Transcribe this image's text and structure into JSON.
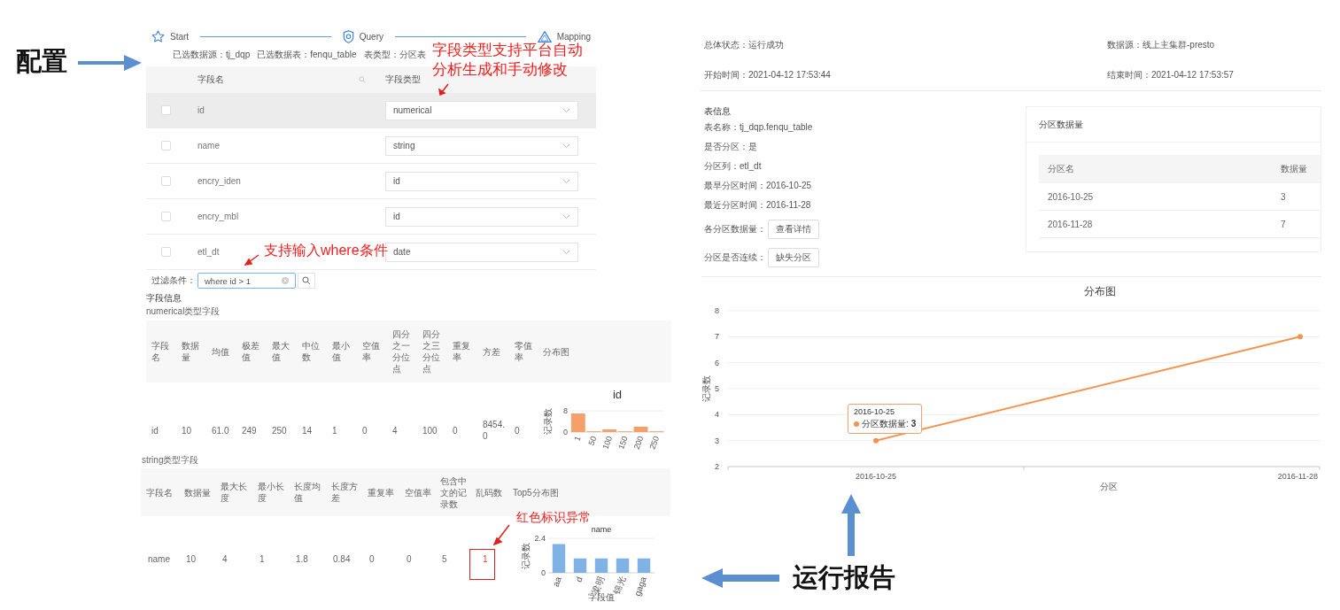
{
  "annotations": [
    {
      "kind": "title",
      "text": "配置"
    },
    {
      "kind": "callout",
      "text": "字段类型支持平台自动分析生成和手动修改"
    },
    {
      "kind": "callout",
      "text": "支持输入where条件"
    },
    {
      "kind": "callout",
      "text": "红色标识异常"
    },
    {
      "kind": "title",
      "text": "运行报告"
    }
  ],
  "config_panel": {
    "steps": [
      {
        "kind": "star",
        "label": "Start"
      },
      {
        "kind": "shield",
        "label": "Query"
      },
      {
        "kind": "triangle",
        "label": "Mapping"
      }
    ],
    "info": [
      "已选数据源：tj_dqp",
      "已选数据表：fenqu_table",
      "表类型：分区表"
    ],
    "columns": [
      "字段名",
      "字段类型"
    ],
    "rows": [
      {
        "name": "id",
        "type": "numerical",
        "checked": false,
        "highlighted": true
      },
      {
        "name": "name",
        "type": "string",
        "checked": false,
        "highlighted": false
      },
      {
        "name": "encry_iden",
        "type": "id",
        "checked": false,
        "highlighted": false
      },
      {
        "name": "encry_mbl",
        "type": "id",
        "checked": false,
        "highlighted": false
      },
      {
        "name": "etl_dt",
        "type": "date",
        "checked": false,
        "highlighted": false
      }
    ],
    "filter": {
      "label": "过滤条件：",
      "value": "where id > 1"
    }
  },
  "field_info": {
    "title": "字段信息",
    "subtitle": "numerical类型字段",
    "columns": [
      "字段名",
      "数据量",
      "均值",
      "极差值",
      "最大值",
      "中位数",
      "最小值",
      "空值率",
      "四分之一分位点",
      "四分之三分位点",
      "重复率",
      "方差",
      "零值率",
      "分布图"
    ],
    "rows": [
      {
        "cells": [
          "id",
          "10",
          "61.0",
          "249",
          "250",
          "14",
          "1",
          "0",
          "4",
          "100",
          "0",
          "8454.0",
          "0"
        ],
        "chart_data": {
          "type": "bar",
          "title": "id",
          "ylabel": "记录数",
          "categories": [
            "1",
            "50",
            "100",
            "150",
            "200",
            "250"
          ],
          "yticks": [
            0,
            8
          ],
          "ylim": [
            0,
            8
          ],
          "values": [
            7,
            0,
            1,
            0,
            2,
            0
          ]
        }
      }
    ]
  },
  "string_fields": {
    "subtitle": "string类型字段",
    "columns": [
      "字段名",
      "数据量",
      "最大长度",
      "最小长度",
      "长度均值",
      "长度方差",
      "重复率",
      "空值率",
      "包含中文的记录数",
      "乱码数",
      "Top5分布图"
    ],
    "rows": [
      {
        "cells": [
          {
            "text": "name",
            "anomaly": false
          },
          {
            "text": "10",
            "anomaly": false
          },
          {
            "text": "4",
            "anomaly": false
          },
          {
            "text": "1",
            "anomaly": false
          },
          {
            "text": "1.8",
            "anomaly": false
          },
          {
            "text": "0.84",
            "anomaly": false
          },
          {
            "text": "0",
            "anomaly": false
          },
          {
            "text": "0",
            "anomaly": false
          },
          {
            "text": "5",
            "anomaly": false
          },
          {
            "text": "1",
            "anomaly": true
          }
        ],
        "chart_data": {
          "type": "bar",
          "title": "name",
          "xlabel": "字段值",
          "ylabel": "记录数",
          "categories": [
            "aa",
            "d",
            "梁明",
            "锦光",
            "gaga"
          ],
          "yticks": [
            0,
            2.4
          ],
          "ylim": [
            0,
            2.4
          ],
          "values": [
            2,
            1,
            1,
            1,
            1
          ]
        }
      }
    ]
  },
  "report": {
    "status": [
      {
        "label": "总体状态：",
        "value": "运行成功"
      },
      {
        "label": "数据源：",
        "value": "线上主集群-presto"
      },
      {
        "label": "开始时间：",
        "value": "2021-04-12 17:53:44"
      },
      {
        "label": "结束时间：",
        "value": "2021-04-12 17:53:57"
      }
    ],
    "table_info": {
      "title": "表信息",
      "items": [
        {
          "kind": "text",
          "label": "表名称：",
          "value": "tj_dqp.fenqu_table"
        },
        {
          "kind": "text",
          "label": "是否分区：",
          "value": "是"
        },
        {
          "kind": "text",
          "label": "分区列：",
          "value": "etl_dt"
        },
        {
          "kind": "text",
          "label": "最早分区时间：",
          "value": "2016-10-25"
        },
        {
          "kind": "text",
          "label": "最近分区时间：",
          "value": "2016-11-28"
        },
        {
          "kind": "button",
          "label": "各分区数据量：",
          "value": "查看详情"
        },
        {
          "kind": "button",
          "label": "分区是否连续：",
          "value": "缺失分区"
        }
      ]
    },
    "partition_card": {
      "title": "分区数据量",
      "columns": [
        "分区名",
        "数据量"
      ],
      "rows": [
        [
          "2016-10-25",
          "3"
        ],
        [
          "2016-11-28",
          "7"
        ]
      ]
    }
  },
  "distribution": {
    "tooltip": {
      "title": "2016-10-25",
      "label": "分区数据量:",
      "value": "3"
    },
    "chart_data": {
      "type": "line",
      "title": "分布图",
      "xlabel": "分区",
      "ylabel": "记录数",
      "categories": [
        "2016-10-25",
        "2016-11-28"
      ],
      "ylim": [
        2,
        8
      ],
      "yticks": [
        2,
        3,
        4,
        5,
        6,
        7,
        8
      ],
      "grid": true,
      "series": [
        {
          "color": "#f5944f",
          "marker": true,
          "values": [
            3,
            7
          ]
        }
      ]
    }
  }
}
